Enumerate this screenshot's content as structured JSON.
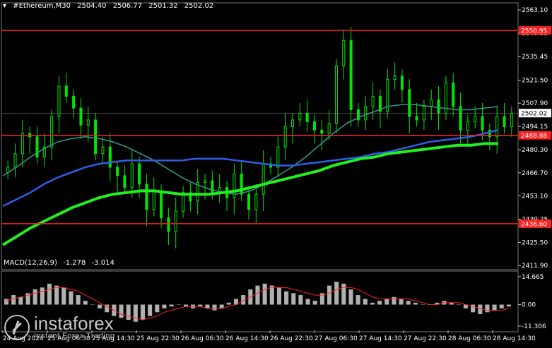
{
  "header": {
    "symbol": "#Ethereum,M30",
    "open": "2504.40",
    "high": "2506.77",
    "low": "2501.32",
    "close": "2502.02",
    "menu_icon": "triangle-down-icon"
  },
  "macd_header": {
    "label": "MACD(12,26,9)",
    "main": "-1.278",
    "signal": "-3.014"
  },
  "watermark": {
    "name": "instaforex",
    "tagline": "Instant Forex Trading"
  },
  "colors": {
    "background": "#000000",
    "candle": "#00e600",
    "ma_fast": "#2e9f8e",
    "ma_mid": "#2f5ee8",
    "ma_slow": "#22ee22",
    "level_line": "#ff1f1f",
    "histogram": "#b0b0b0",
    "signal_line": "#ff2222"
  },
  "chart_data": {
    "type": "candlestick",
    "y_ticks": [
      "2563.10",
      "2549.35",
      "2535.45",
      "2521.50",
      "2507.90",
      "2494.15",
      "2480.30",
      "2466.70",
      "2453.10",
      "2439.25",
      "2425.50",
      "2411.90"
    ],
    "ylim": [
      2411.9,
      2563.1
    ],
    "price_levels": [
      {
        "label": "2550.95",
        "value": 2550.95
      },
      {
        "label": "2488.88",
        "value": 2488.88
      },
      {
        "label": "2436.60",
        "value": 2436.6
      }
    ],
    "current_price": {
      "label": "2502.02",
      "value": 2502.02
    },
    "x_labels": [
      "24 Aug 2024",
      "25 Aug 06:30",
      "25 Aug 14:30",
      "25 Aug 22:30",
      "26 Aug 06:30",
      "26 Aug 14:30",
      "26 Aug 22:30",
      "27 Aug 06:30",
      "27 Aug 14:30",
      "27 Aug 22:30",
      "28 Aug 06:30",
      "28 Aug 14:30"
    ],
    "price_series": [
      2470,
      2478,
      2490,
      2488,
      2476,
      2482,
      2500,
      2518,
      2512,
      2505,
      2495,
      2498,
      2478,
      2482,
      2470,
      2465,
      2458,
      2472,
      2460,
      2445,
      2456,
      2440,
      2432,
      2444,
      2455,
      2450,
      2461,
      2462,
      2455,
      2458,
      2452,
      2466,
      2454,
      2445,
      2454,
      2472,
      2470,
      2482,
      2494,
      2498,
      2502,
      2497,
      2492,
      2490,
      2496,
      2530,
      2545,
      2504,
      2498,
      2506,
      2512,
      2503,
      2522,
      2524,
      2516,
      2500,
      2498,
      2506,
      2510,
      2502,
      2520,
      2506,
      2492,
      2497,
      2500,
      2492,
      2488,
      2500,
      2494,
      2502
    ],
    "series": [
      {
        "name": "MA fast",
        "values": [
          2465,
          2470,
          2476,
          2481,
          2485,
          2487,
          2488,
          2487,
          2485,
          2482,
          2478,
          2474,
          2469,
          2464,
          2460,
          2457,
          2455,
          2454,
          2456,
          2460,
          2465,
          2470,
          2476,
          2483,
          2490,
          2496,
          2500,
          2503,
          2506,
          2507,
          2507,
          2506,
          2505,
          2504,
          2504,
          2505,
          2506
        ]
      },
      {
        "name": "MA mid",
        "values": [
          2447,
          2451,
          2455,
          2460,
          2464,
          2467,
          2470,
          2472,
          2473,
          2474,
          2474,
          2474,
          2474,
          2474,
          2475,
          2475,
          2475,
          2474,
          2473,
          2472,
          2471,
          2471,
          2472,
          2473,
          2474,
          2475,
          2476,
          2478,
          2479,
          2481,
          2483,
          2485,
          2486,
          2487,
          2488,
          2490,
          2492
        ]
      },
      {
        "name": "MA slow",
        "values": [
          2424,
          2429,
          2434,
          2438,
          2442,
          2446,
          2449,
          2452,
          2454,
          2455,
          2456,
          2456,
          2455,
          2454,
          2454,
          2454,
          2455,
          2456,
          2458,
          2460,
          2462,
          2464,
          2466,
          2468,
          2471,
          2473,
          2475,
          2476,
          2478,
          2479,
          2480,
          2481,
          2482,
          2483,
          2483,
          2484,
          2484
        ]
      }
    ],
    "macd": {
      "y_ticks": [
        "14.665",
        "0.00",
        "-11.306"
      ],
      "ylim": [
        -11.306,
        14.665
      ],
      "histogram": [
        3,
        5,
        4,
        6,
        8,
        9,
        11,
        10,
        9,
        7,
        5,
        2,
        0,
        -2,
        -4,
        -6,
        -7,
        -8,
        -9,
        -8,
        -6,
        -4,
        -2,
        -1,
        0,
        -1,
        -2,
        -1,
        -2,
        -3,
        -2,
        1,
        3,
        5,
        8,
        10,
        11,
        10,
        9,
        7,
        6,
        5,
        3,
        2,
        6,
        10,
        12,
        11,
        8,
        5,
        3,
        1,
        2,
        3,
        4,
        3,
        2,
        1,
        0,
        0,
        1,
        2,
        1,
        0,
        -2,
        -4,
        -5,
        -4,
        -3,
        -2,
        -1
      ],
      "signal": [
        2,
        3,
        4,
        5,
        6,
        7,
        8,
        9,
        9,
        8,
        7,
        5,
        3,
        1,
        -1,
        -3,
        -5,
        -6,
        -7,
        -8,
        -7,
        -6,
        -4,
        -3,
        -2,
        -1,
        -1,
        -1,
        -2,
        -2,
        -2,
        -1,
        0,
        2,
        4,
        6,
        8,
        9,
        9,
        9,
        8,
        7,
        6,
        5,
        5,
        6,
        8,
        9,
        9,
        8,
        6,
        4,
        3,
        3,
        3,
        3,
        3,
        2,
        1,
        0,
        0,
        1,
        1,
        1,
        0,
        -1,
        -2,
        -3,
        -3,
        -3,
        -2
      ]
    }
  }
}
